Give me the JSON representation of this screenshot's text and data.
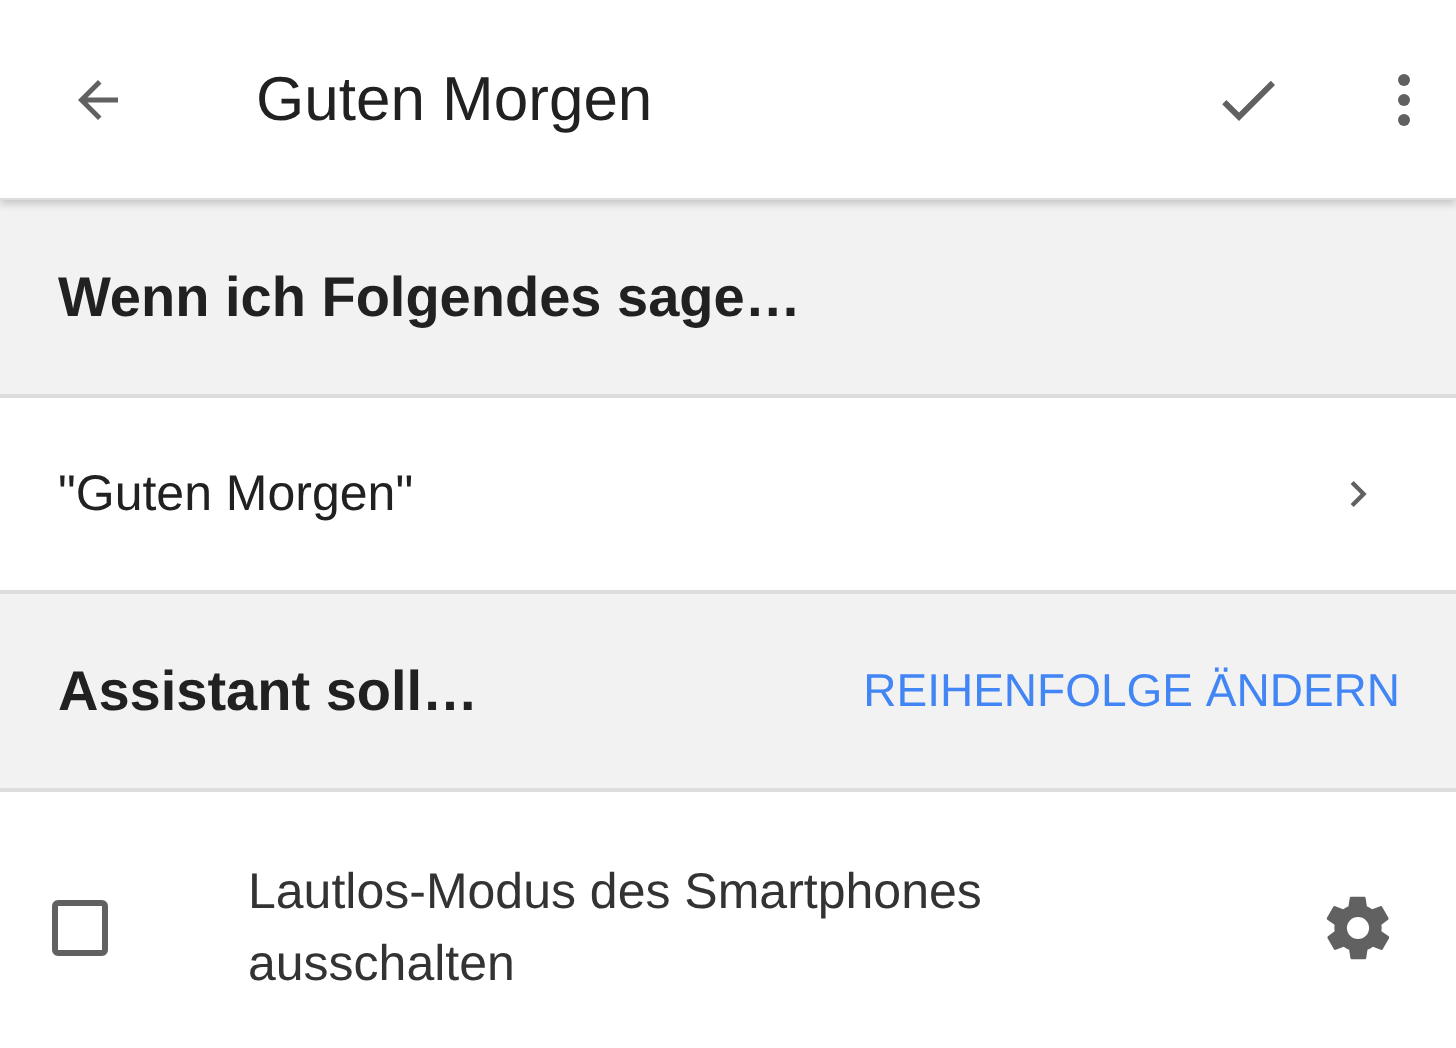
{
  "app_bar": {
    "title": "Guten Morgen"
  },
  "trigger_section": {
    "heading": "Wenn ich Folgendes sage…",
    "phrases": [
      {
        "text": "\"Guten Morgen\""
      }
    ]
  },
  "action_section": {
    "heading": "Assistant soll…",
    "reorder_link": "REIHENFOLGE ÄNDERN",
    "actions": [
      {
        "label": "Lautlos-Modus des Smartphones ausschalten",
        "checked": false
      }
    ]
  }
}
